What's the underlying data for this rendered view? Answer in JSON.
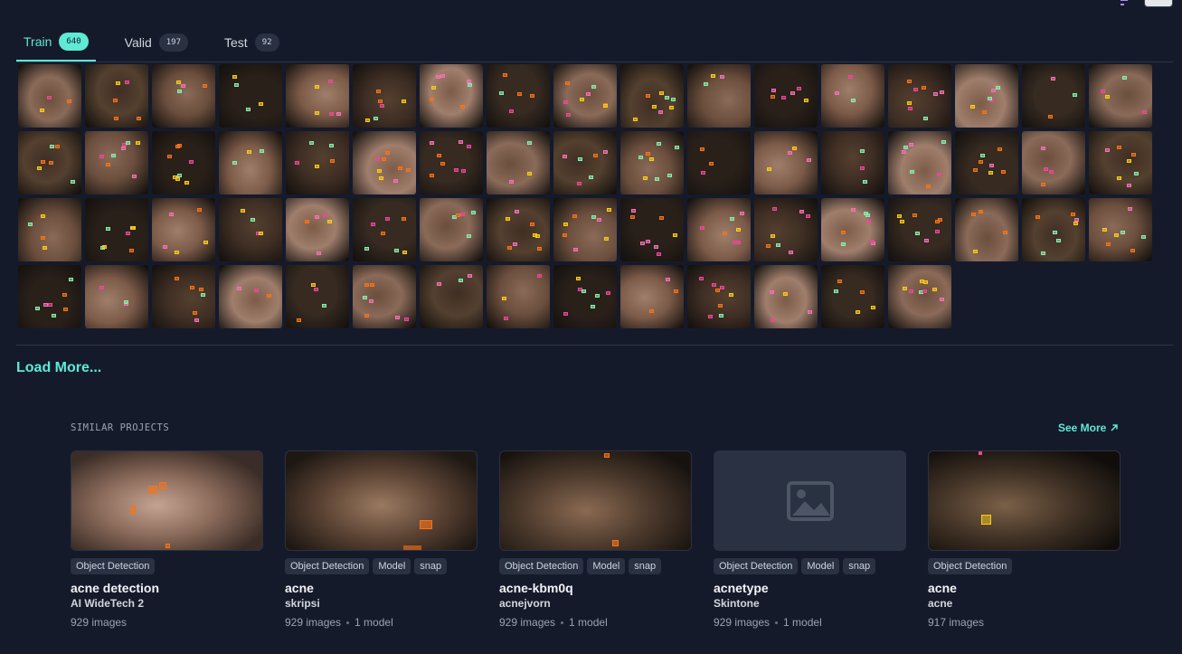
{
  "tabs": [
    {
      "label": "Train",
      "count": "640",
      "active": true
    },
    {
      "label": "Valid",
      "count": "197",
      "active": false
    },
    {
      "label": "Test",
      "count": "92",
      "active": false
    }
  ],
  "thumbnail_count": 65,
  "load_more_label": "Load More...",
  "similar": {
    "title": "SIMILAR PROJECTS",
    "see_more_label": "See More",
    "cards": [
      {
        "name": "acne detection",
        "owner": "AI WideTech 2",
        "images": "929 images",
        "models": "",
        "tags": [
          "Object Detection"
        ],
        "placeholder": false
      },
      {
        "name": "acne",
        "owner": "skripsi",
        "images": "929 images",
        "models": "1 model",
        "tags": [
          "Object Detection",
          "Model",
          "snap"
        ],
        "placeholder": false
      },
      {
        "name": "acne-kbm0q",
        "owner": "acnejvorn",
        "images": "929 images",
        "models": "1 model",
        "tags": [
          "Object Detection",
          "Model",
          "snap"
        ],
        "placeholder": false
      },
      {
        "name": "acnetype",
        "owner": "Skintone",
        "images": "929 images",
        "models": "1 model",
        "tags": [
          "Object Detection",
          "Model",
          "snap"
        ],
        "placeholder": true
      },
      {
        "name": "acne",
        "owner": "acne",
        "images": "917 images",
        "models": "",
        "tags": [
          "Object Detection"
        ],
        "placeholder": false
      }
    ]
  },
  "colors": {
    "accent": "#5eead4",
    "background": "#151a2b",
    "annotation_orange": "#f97316",
    "annotation_pink": "#ec4899"
  },
  "icons": {
    "sort": "sort-icon",
    "grid_view": "grid-view-icon",
    "see_more": "arrow-up-right-icon",
    "placeholder": "image-placeholder-icon"
  }
}
